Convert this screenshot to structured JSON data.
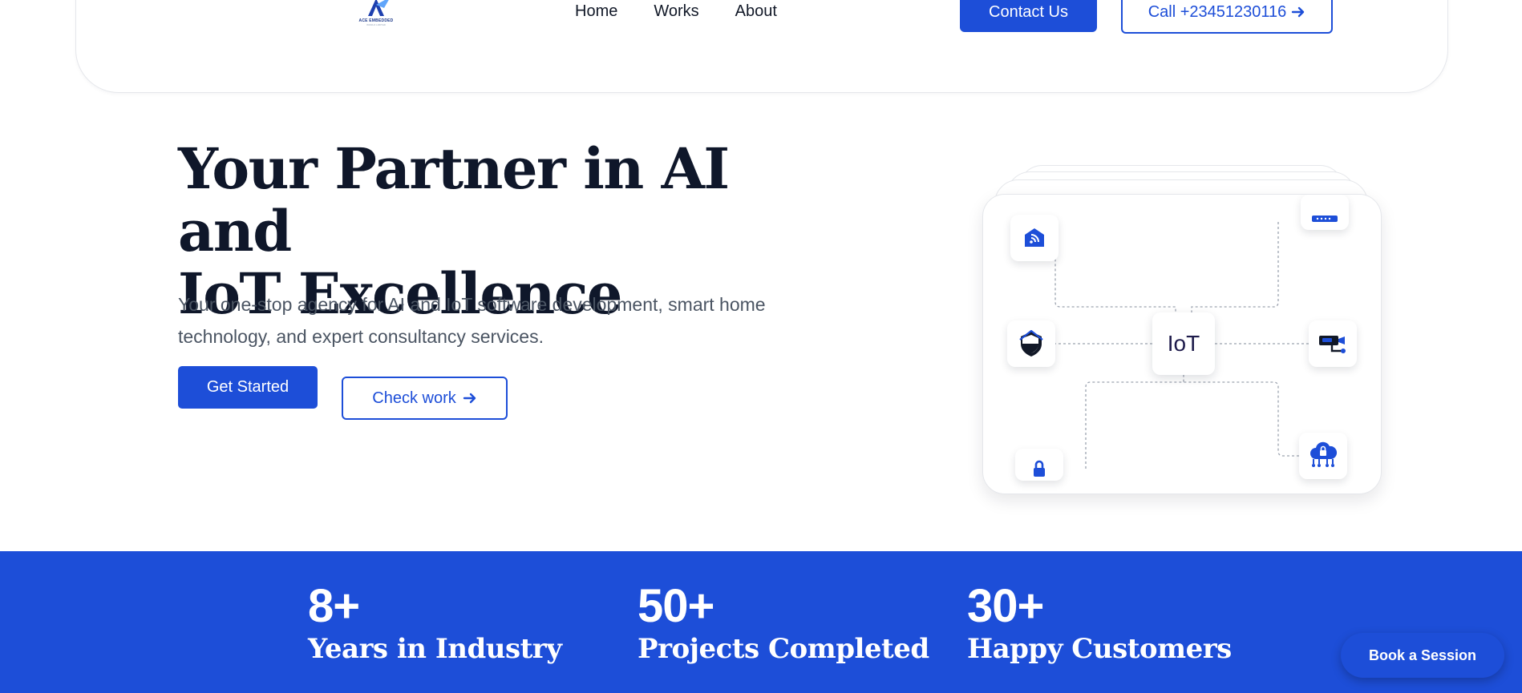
{
  "header": {
    "logo_text": "ACE EMBEDDED",
    "logo_subtext": "WORLD LIMITED",
    "nav": [
      {
        "label": "Home"
      },
      {
        "label": "Works"
      },
      {
        "label": "About"
      }
    ],
    "contact_label": "Contact Us",
    "call_label": "Call +23451230116"
  },
  "hero": {
    "title_line1": "Your Partner in AI and",
    "title_line2": "IoT Excellence",
    "subtitle_line1": "Your one-stop agency for AI and IoT software development, smart home",
    "subtitle_line2": "technology, and expert consultancy services.",
    "primary_cta": "Get Started",
    "secondary_cta": "Check work"
  },
  "iot_card": {
    "center_label": "IoT",
    "nodes": [
      {
        "icon": "smart-home-wifi-icon"
      },
      {
        "icon": "router-icon"
      },
      {
        "icon": "security-shield-icon"
      },
      {
        "icon": "security-camera-icon"
      },
      {
        "icon": "padlock-icon"
      },
      {
        "icon": "cloud-lock-icon"
      }
    ]
  },
  "stats": [
    {
      "value": "8+",
      "label": "Years in Industry"
    },
    {
      "value": "50+",
      "label": "Projects Completed"
    },
    {
      "value": "30+",
      "label": "Happy Customers"
    }
  ],
  "floating_cta": "Book a Session",
  "colors": {
    "primary": "#1d4ed8",
    "heading": "#0f172a",
    "body": "#4b5563"
  }
}
